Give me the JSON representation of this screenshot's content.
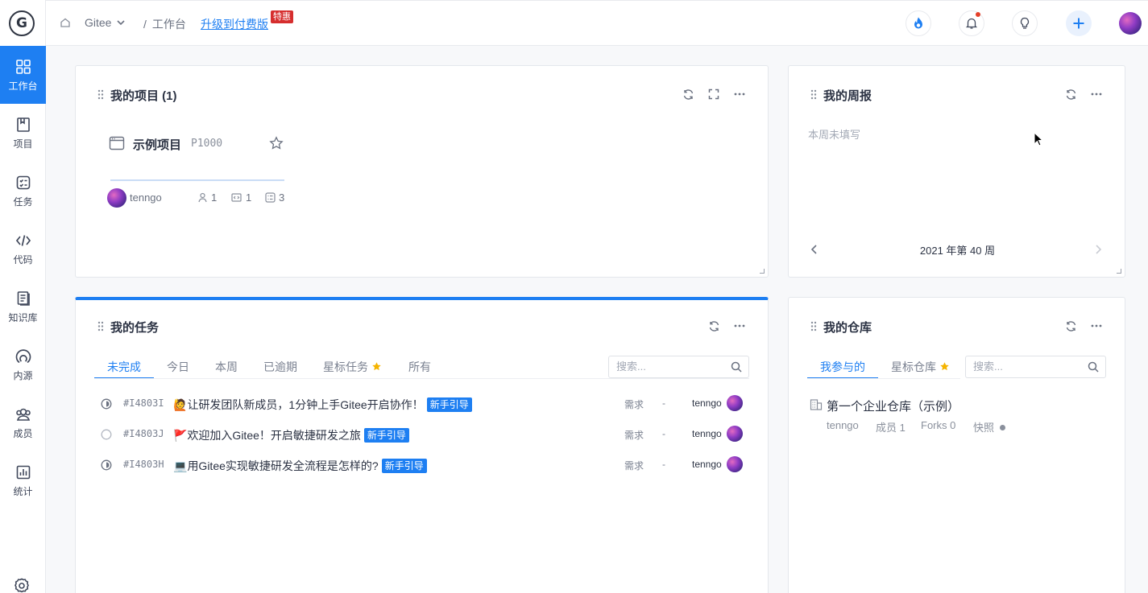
{
  "sidebar": {
    "logo_letter": "G",
    "items": [
      {
        "label": "工作台",
        "icon": "dashboard-icon",
        "active": true
      },
      {
        "label": "项目",
        "icon": "book-icon"
      },
      {
        "label": "任务",
        "icon": "task-list-icon"
      },
      {
        "label": "代码",
        "icon": "code-icon"
      },
      {
        "label": "知识库",
        "icon": "document-icon"
      },
      {
        "label": "内源",
        "icon": "inner-source-icon"
      },
      {
        "label": "成员",
        "icon": "members-icon"
      },
      {
        "label": "统计",
        "icon": "bar-chart-icon"
      }
    ]
  },
  "header": {
    "org": "Gitee",
    "sep": "/",
    "crumb": "工作台",
    "upgrade": "升级到付费版",
    "hot_badge": "特惠"
  },
  "projects": {
    "title": "我的项目 (1)",
    "item": {
      "name": "示例项目",
      "code": "P1000",
      "owner": "tenngo",
      "members": "1",
      "repos": "1",
      "tasks": "3",
      "progress": 1.0
    }
  },
  "weekly": {
    "title": "我的周报",
    "empty": "本周未填写",
    "week": "2021 年第 40 周"
  },
  "tasks": {
    "title": "我的任务",
    "tabs": [
      "未完成",
      "今日",
      "本周",
      "已逾期",
      "星标任务",
      "所有"
    ],
    "search_placeholder": "搜索...",
    "rows": [
      {
        "id": "#I4803I",
        "emoji": "🙋",
        "title": "让研发团队新成员，1分钟上手Gitee开启协作！",
        "tag": "新手引导",
        "type": "需求",
        "dash": "-",
        "user": "tenngo",
        "status": "half"
      },
      {
        "id": "#I4803J",
        "emoji": "🚩",
        "title": "欢迎加入Gitee！开启敏捷研发之旅",
        "tag": "新手引导",
        "type": "需求",
        "dash": "-",
        "user": "tenngo",
        "status": "empty"
      },
      {
        "id": "#I4803H",
        "emoji": "💻",
        "title": "用Gitee实现敏捷研发全流程是怎样的?",
        "tag": "新手引导",
        "type": "需求",
        "dash": "-",
        "user": "tenngo",
        "status": "half"
      }
    ]
  },
  "repos": {
    "title": "我的仓库",
    "tabs": [
      "我参与的",
      "星标仓库"
    ],
    "search_placeholder": "搜索...",
    "item": {
      "name": "第一个企业仓库（示例）",
      "owner": "tenngo",
      "members": "成员 1",
      "forks": "Forks 0",
      "snapshot": "快照"
    }
  },
  "colors": {
    "accent": "#1e7ff2",
    "hot": "#d62e2e",
    "star": "#f5b400"
  }
}
